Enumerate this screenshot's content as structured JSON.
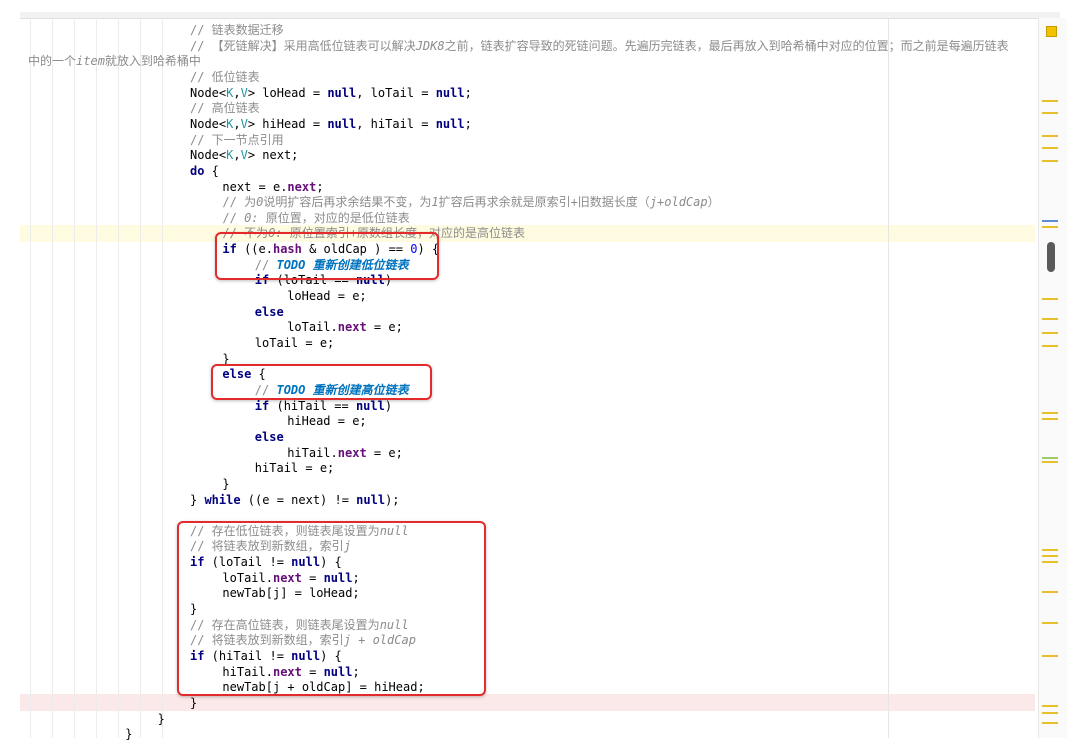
{
  "editor": {
    "lines": [
      {
        "indent": "                    ",
        "tokens": [
          {
            "t": "// 链表数据迁移",
            "c": "cm"
          }
        ]
      },
      {
        "indent": "                    ",
        "tokens": [
          {
            "t": "// 【死链解决】采用高低位链表可以解决",
            "c": "cm"
          },
          {
            "t": "JDK8",
            "c": "cm cmit"
          },
          {
            "t": "之前，链表扩容导致的死链问题。先遍历完链表，最后再放入到哈希桶中对应的位置；而之前是每遍历链表",
            "c": "cm"
          }
        ]
      },
      {
        "indent": "",
        "tokens": [
          {
            "t": "中的一个",
            "c": "cm"
          },
          {
            "t": "item",
            "c": "cm cmit"
          },
          {
            "t": "就放入到哈希桶中",
            "c": "cm"
          }
        ]
      },
      {
        "indent": "                    ",
        "tokens": [
          {
            "t": "// 低位链表",
            "c": "cm"
          }
        ]
      },
      {
        "indent": "                    ",
        "tokens": [
          {
            "t": "Node<"
          },
          {
            "t": "K",
            "c": "gen"
          },
          {
            "t": ","
          },
          {
            "t": "V",
            "c": "gen"
          },
          {
            "t": "> loHead = "
          },
          {
            "t": "null",
            "c": "kw"
          },
          {
            "t": ", loTail = "
          },
          {
            "t": "null",
            "c": "kw"
          },
          {
            "t": ";"
          }
        ]
      },
      {
        "indent": "                    ",
        "tokens": [
          {
            "t": "// 高位链表",
            "c": "cm"
          }
        ]
      },
      {
        "indent": "                    ",
        "tokens": [
          {
            "t": "Node<"
          },
          {
            "t": "K",
            "c": "gen"
          },
          {
            "t": ","
          },
          {
            "t": "V",
            "c": "gen"
          },
          {
            "t": "> hiHead = "
          },
          {
            "t": "null",
            "c": "kw"
          },
          {
            "t": ", hiTail = "
          },
          {
            "t": "null",
            "c": "kw"
          },
          {
            "t": ";"
          }
        ]
      },
      {
        "indent": "                    ",
        "tokens": [
          {
            "t": "// 下一节点引用",
            "c": "cm"
          }
        ]
      },
      {
        "indent": "                    ",
        "tokens": [
          {
            "t": "Node<"
          },
          {
            "t": "K",
            "c": "gen"
          },
          {
            "t": ","
          },
          {
            "t": "V",
            "c": "gen"
          },
          {
            "t": "> next;"
          }
        ]
      },
      {
        "indent": "                    ",
        "tokens": [
          {
            "t": "do",
            "c": "kw"
          },
          {
            "t": " {"
          }
        ]
      },
      {
        "indent": "                        ",
        "tokens": [
          {
            "t": "next = e."
          },
          {
            "t": "next",
            "c": "fld"
          },
          {
            "t": ";"
          }
        ]
      },
      {
        "indent": "                        ",
        "tokens": [
          {
            "t": "// 为",
            "c": "cm"
          },
          {
            "t": "0",
            "c": "cm cmit"
          },
          {
            "t": "说明扩容后再求余结果不变，为",
            "c": "cm"
          },
          {
            "t": "1",
            "c": "cm cmit"
          },
          {
            "t": "扩容后再求余就是原索引+旧数据长度（",
            "c": "cm"
          },
          {
            "t": "j+oldCap",
            "c": "cm cmit"
          },
          {
            "t": "）",
            "c": "cm"
          }
        ]
      },
      {
        "indent": "                        ",
        "tokens": [
          {
            "t": "// ",
            "c": "cm"
          },
          {
            "t": "0:",
            "c": "cm cmit"
          },
          {
            "t": " 原位置，对应的是低位链表",
            "c": "cm"
          }
        ]
      },
      {
        "indent": "                        ",
        "tokens": [
          {
            "t": "// 不为",
            "c": "cm"
          },
          {
            "t": "0:",
            "c": "cm cmit"
          },
          {
            "t": " 原位置索引+原数组长度，对应的是高位链表",
            "c": "cm"
          }
        ]
      },
      {
        "indent": "                        ",
        "tokens": [
          {
            "t": "if",
            "c": "kw"
          },
          {
            "t": " ((e."
          },
          {
            "t": "hash",
            "c": "fld"
          },
          {
            "t": " & oldCap ) == "
          },
          {
            "t": "0",
            "c": "num"
          },
          {
            "t": ") {"
          }
        ]
      },
      {
        "indent": "                            ",
        "tokens": [
          {
            "t": "// ",
            "c": "cm"
          },
          {
            "t": "TODO 重新创建低位链表",
            "c": "todo"
          }
        ]
      },
      {
        "indent": "                            ",
        "tokens": [
          {
            "t": "if",
            "c": "kw"
          },
          {
            "t": " (loTail == "
          },
          {
            "t": "null",
            "c": "kw"
          },
          {
            "t": ")"
          }
        ]
      },
      {
        "indent": "                                ",
        "tokens": [
          {
            "t": "loHead = e;"
          }
        ]
      },
      {
        "indent": "                            ",
        "tokens": [
          {
            "t": "else",
            "c": "kw"
          }
        ]
      },
      {
        "indent": "                                ",
        "tokens": [
          {
            "t": "loTail."
          },
          {
            "t": "next",
            "c": "fld"
          },
          {
            "t": " = e;"
          }
        ]
      },
      {
        "indent": "                            ",
        "tokens": [
          {
            "t": "loTail = e;"
          }
        ]
      },
      {
        "indent": "                        ",
        "tokens": [
          {
            "t": "}"
          }
        ]
      },
      {
        "indent": "                        ",
        "tokens": [
          {
            "t": "else",
            "c": "kw"
          },
          {
            "t": " {"
          }
        ]
      },
      {
        "indent": "                            ",
        "tokens": [
          {
            "t": "// ",
            "c": "cm"
          },
          {
            "t": "TODO 重新创建高位链表",
            "c": "todo"
          }
        ]
      },
      {
        "indent": "                            ",
        "tokens": [
          {
            "t": "if",
            "c": "kw"
          },
          {
            "t": " (hiTail == "
          },
          {
            "t": "null",
            "c": "kw"
          },
          {
            "t": ")"
          }
        ]
      },
      {
        "indent": "                                ",
        "tokens": [
          {
            "t": "hiHead = e;"
          }
        ]
      },
      {
        "indent": "                            ",
        "tokens": [
          {
            "t": "else",
            "c": "kw"
          }
        ]
      },
      {
        "indent": "                                ",
        "tokens": [
          {
            "t": "hiTail."
          },
          {
            "t": "next",
            "c": "fld"
          },
          {
            "t": " = e;"
          }
        ]
      },
      {
        "indent": "                            ",
        "tokens": [
          {
            "t": "hiTail = e;"
          }
        ]
      },
      {
        "indent": "                        ",
        "tokens": [
          {
            "t": "}"
          }
        ]
      },
      {
        "indent": "                    ",
        "tokens": [
          {
            "t": "} "
          },
          {
            "t": "while",
            "c": "kw"
          },
          {
            "t": " ((e = next) != "
          },
          {
            "t": "null",
            "c": "kw"
          },
          {
            "t": ");"
          }
        ]
      },
      {
        "indent": "",
        "tokens": []
      },
      {
        "indent": "                    ",
        "tokens": [
          {
            "t": "// 存在低位链表，则链表尾设置为",
            "c": "cm"
          },
          {
            "t": "null",
            "c": "cm cmit"
          }
        ]
      },
      {
        "indent": "                    ",
        "tokens": [
          {
            "t": "// 将链表放到新数组，索引",
            "c": "cm"
          },
          {
            "t": "j",
            "c": "cm cmit"
          }
        ]
      },
      {
        "indent": "                    ",
        "tokens": [
          {
            "t": "if",
            "c": "kw"
          },
          {
            "t": " (loTail != "
          },
          {
            "t": "null",
            "c": "kw"
          },
          {
            "t": ") {"
          }
        ]
      },
      {
        "indent": "                        ",
        "tokens": [
          {
            "t": "loTail."
          },
          {
            "t": "next",
            "c": "fld"
          },
          {
            "t": " = "
          },
          {
            "t": "null",
            "c": "kw"
          },
          {
            "t": ";"
          }
        ]
      },
      {
        "indent": "                        ",
        "tokens": [
          {
            "t": "newTab[j] = loHead;"
          }
        ]
      },
      {
        "indent": "                    ",
        "tokens": [
          {
            "t": "}"
          }
        ]
      },
      {
        "indent": "                    ",
        "tokens": [
          {
            "t": "// 存在高位链表，则链表尾设置为",
            "c": "cm"
          },
          {
            "t": "null",
            "c": "cm cmit"
          }
        ]
      },
      {
        "indent": "                    ",
        "tokens": [
          {
            "t": "// 将链表放到新数组，索引",
            "c": "cm"
          },
          {
            "t": "j + oldCap",
            "c": "cm cmit"
          }
        ]
      },
      {
        "indent": "                    ",
        "tokens": [
          {
            "t": "if",
            "c": "kw"
          },
          {
            "t": " (hiTail != "
          },
          {
            "t": "null",
            "c": "kw"
          },
          {
            "t": ") {"
          }
        ]
      },
      {
        "indent": "                        ",
        "tokens": [
          {
            "t": "hiTail."
          },
          {
            "t": "next",
            "c": "fld"
          },
          {
            "t": " = "
          },
          {
            "t": "null",
            "c": "kw"
          },
          {
            "t": ";"
          }
        ]
      },
      {
        "indent": "                        ",
        "tokens": [
          {
            "t": "newTab[j + oldCap] = hiHead;"
          }
        ]
      },
      {
        "indent": "                    ",
        "tokens": [
          {
            "t": "}"
          }
        ]
      },
      {
        "indent": "                ",
        "tokens": [
          {
            "t": "}"
          }
        ]
      },
      {
        "indent": "            ",
        "tokens": [
          {
            "t": "}"
          }
        ]
      }
    ]
  },
  "colors": {
    "comment": "#8c8c8c",
    "keyword": "#000080",
    "field": "#660e7a",
    "generic": "#20999d",
    "number": "#0000ff",
    "todo": "#0073bf",
    "highlight_box": "#e32b2b"
  }
}
